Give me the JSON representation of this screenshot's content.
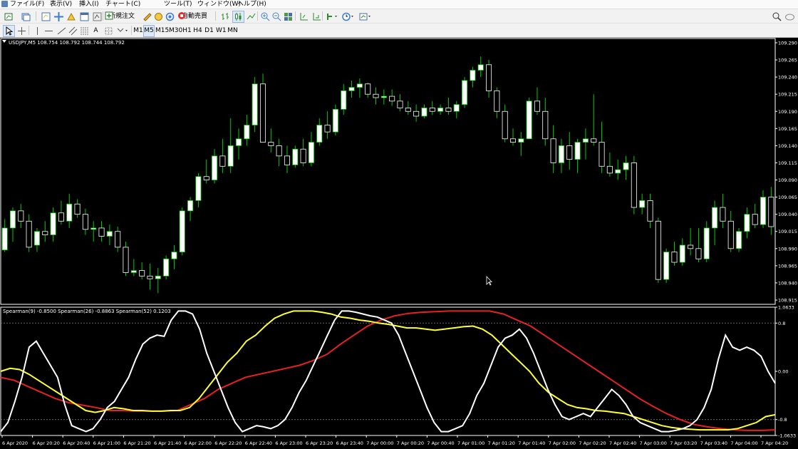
{
  "menu": {
    "items": [
      "ファイル(F)",
      "表示(V)",
      "挿入(I)",
      "チャート(C)",
      "ツール(T)",
      "ウィンドウ(W)",
      "ヘルプ(H)"
    ]
  },
  "toolbar": {
    "new_order_label": "新規注文",
    "auto_trade_label": "自動売買",
    "timeframes": [
      "M1",
      "M5",
      "M15",
      "M30",
      "H1",
      "H4",
      "D1",
      "W1",
      "MN"
    ],
    "active_timeframe": "M5",
    "text_tool_label": "A"
  },
  "price_chart": {
    "header": "USDJPY,M5  108.754 108.792 108.744 108.792",
    "price_labels": [
      "109.290",
      "109.265",
      "109.240",
      "109.215",
      "109.190",
      "109.165",
      "109.140",
      "109.115",
      "109.090",
      "109.065",
      "109.040",
      "109.015",
      "108.990",
      "108.965",
      "108.940",
      "108.915"
    ]
  },
  "indicator": {
    "header": "Spearman(9) -0.8500  Spearman(26) -0.8863  Spearman(52) 0.1203",
    "scale_labels": [
      "1.0633",
      "0.8",
      "0.00",
      "-0.8",
      "-1.0633"
    ]
  },
  "time_axis": {
    "labels": [
      "6 Apr 2020",
      "6 Apr 20:20",
      "6 Apr 20:40",
      "6 Apr 21:00",
      "6 Apr 21:20",
      "6 Apr 21:40",
      "6 Apr 22:00",
      "6 Apr 22:20",
      "6 Apr 22:40",
      "6 Apr 23:00",
      "6 Apr 23:20",
      "6 Apr 23:40",
      "7 Apr 00:00",
      "7 Apr 00:20",
      "7 Apr 00:40",
      "7 Apr 01:00",
      "7 Apr 01:20",
      "7 Apr 01:40",
      "7 Apr 02:00",
      "7 Apr 02:20",
      "7 Apr 02:40",
      "7 Apr 03:00",
      "7 Apr 03:20",
      "7 Apr 03:40",
      "7 Apr 04:00",
      "7 Apr 04:20"
    ]
  },
  "colors": {
    "chart_bg": "#000000",
    "bull_body": "#ffffff",
    "wick": "#00cc00",
    "spearman_fast": "#ffffff",
    "spearman_mid": "#ffff33",
    "spearman_slow": "#e52222",
    "level_line": "#888888"
  },
  "chart_data": {
    "type": "candlestick",
    "symbol": "USDJPY",
    "timeframe": "M5",
    "ylim": [
      108.915,
      109.29
    ],
    "candles": [
      [
        108.988,
        109.033,
        108.985,
        109.02
      ],
      [
        109.02,
        109.05,
        109.0,
        109.045
      ],
      [
        109.045,
        109.055,
        109.02,
        109.03
      ],
      [
        109.03,
        109.04,
        108.985,
        108.992
      ],
      [
        108.995,
        109.02,
        108.985,
        109.015
      ],
      [
        109.015,
        109.03,
        109.0,
        109.01
      ],
      [
        109.01,
        109.05,
        109.0,
        109.042
      ],
      [
        109.042,
        109.06,
        109.025,
        109.03
      ],
      [
        109.03,
        109.07,
        109.02,
        109.055
      ],
      [
        109.055,
        109.062,
        109.035,
        109.04
      ],
      [
        109.04,
        109.048,
        109.01,
        109.018
      ],
      [
        109.018,
        109.03,
        109.0,
        109.02
      ],
      [
        109.02,
        109.03,
        109.0,
        109.008
      ],
      [
        109.008,
        109.025,
        108.995,
        109.015
      ],
      [
        109.015,
        109.022,
        108.985,
        108.992
      ],
      [
        108.992,
        109.0,
        108.95,
        108.955
      ],
      [
        108.955,
        108.975,
        108.95,
        108.958
      ],
      [
        108.958,
        108.97,
        108.945,
        108.95
      ],
      [
        108.95,
        108.968,
        108.93,
        108.946
      ],
      [
        108.946,
        108.962,
        108.925,
        108.95
      ],
      [
        108.95,
        108.98,
        108.945,
        108.975
      ],
      [
        108.975,
        108.995,
        108.96,
        108.985
      ],
      [
        108.985,
        109.05,
        108.98,
        109.045
      ],
      [
        109.045,
        109.065,
        109.03,
        109.06
      ],
      [
        109.06,
        109.1,
        109.05,
        109.095
      ],
      [
        109.095,
        109.12,
        109.085,
        109.09
      ],
      [
        109.09,
        109.135,
        109.085,
        109.125
      ],
      [
        109.125,
        109.15,
        109.1,
        109.11
      ],
      [
        109.11,
        109.18,
        109.1,
        109.14
      ],
      [
        109.14,
        109.165,
        109.12,
        109.15
      ],
      [
        109.15,
        109.185,
        109.14,
        109.17
      ],
      [
        109.17,
        109.24,
        109.16,
        109.23
      ],
      [
        109.23,
        109.245,
        109.15,
        109.145
      ],
      [
        109.145,
        109.165,
        109.13,
        109.14
      ],
      [
        109.14,
        109.15,
        109.11,
        109.125
      ],
      [
        109.125,
        109.14,
        109.1,
        109.112
      ],
      [
        109.112,
        109.14,
        109.108,
        109.135
      ],
      [
        109.135,
        109.15,
        109.11,
        109.115
      ],
      [
        109.115,
        109.16,
        109.11,
        109.145
      ],
      [
        109.145,
        109.18,
        109.14,
        109.17
      ],
      [
        109.17,
        109.19,
        109.15,
        109.16
      ],
      [
        109.16,
        109.2,
        109.155,
        109.193
      ],
      [
        109.193,
        109.23,
        109.185,
        109.22
      ],
      [
        109.22,
        109.235,
        109.21,
        109.225
      ],
      [
        109.225,
        109.238,
        109.21,
        109.23
      ],
      [
        109.23,
        109.232,
        109.21,
        109.215
      ],
      [
        109.215,
        109.225,
        109.2,
        109.21
      ],
      [
        109.21,
        109.222,
        109.2,
        109.212
      ],
      [
        109.212,
        109.222,
        109.198,
        109.205
      ],
      [
        109.205,
        109.215,
        109.19,
        109.195
      ],
      [
        109.195,
        109.205,
        109.185,
        109.19
      ],
      [
        109.19,
        109.2,
        109.175,
        109.183
      ],
      [
        109.183,
        109.2,
        109.18,
        109.195
      ],
      [
        109.195,
        109.205,
        109.185,
        109.19
      ],
      [
        109.19,
        109.2,
        109.185,
        109.195
      ],
      [
        109.195,
        109.21,
        109.185,
        109.19
      ],
      [
        109.19,
        109.205,
        109.18,
        109.2
      ],
      [
        109.2,
        109.24,
        109.195,
        109.235
      ],
      [
        109.235,
        109.255,
        109.225,
        109.25
      ],
      [
        109.25,
        109.27,
        109.24,
        109.258
      ],
      [
        109.258,
        109.265,
        109.21,
        109.22
      ],
      [
        109.22,
        109.225,
        109.18,
        109.19
      ],
      [
        109.19,
        109.2,
        109.145,
        109.15
      ],
      [
        109.15,
        109.165,
        109.14,
        109.145
      ],
      [
        109.145,
        109.16,
        109.125,
        109.15
      ],
      [
        109.15,
        109.21,
        109.15,
        109.205
      ],
      [
        109.205,
        109.225,
        109.185,
        109.19
      ],
      [
        109.19,
        109.21,
        109.14,
        109.15
      ],
      [
        109.15,
        109.17,
        109.1,
        109.115
      ],
      [
        109.115,
        109.15,
        109.1,
        109.14
      ],
      [
        109.14,
        109.16,
        109.105,
        109.12
      ],
      [
        109.12,
        109.15,
        109.1,
        109.145
      ],
      [
        109.145,
        109.165,
        109.12,
        109.15
      ],
      [
        109.15,
        109.215,
        109.14,
        109.145
      ],
      [
        109.145,
        109.175,
        109.1,
        109.11
      ],
      [
        109.11,
        109.13,
        109.095,
        109.1
      ],
      [
        109.1,
        109.12,
        109.09,
        109.105
      ],
      [
        109.105,
        109.125,
        109.09,
        109.115
      ],
      [
        109.115,
        109.125,
        109.04,
        109.05
      ],
      [
        109.05,
        109.07,
        109.04,
        109.06
      ],
      [
        109.06,
        109.07,
        109.02,
        109.03
      ],
      [
        109.03,
        109.035,
        108.94,
        108.945
      ],
      [
        108.945,
        108.99,
        108.94,
        108.985
      ],
      [
        108.985,
        109.0,
        108.965,
        108.97
      ],
      [
        108.97,
        109.005,
        108.965,
        108.995
      ],
      [
        108.995,
        109.02,
        108.98,
        108.99
      ],
      [
        108.99,
        109.02,
        108.97,
        108.975
      ],
      [
        108.975,
        109.03,
        108.97,
        109.02
      ],
      [
        109.02,
        109.06,
        108.995,
        109.05
      ],
      [
        109.05,
        109.07,
        109.02,
        109.03
      ],
      [
        109.03,
        109.045,
        108.985,
        108.99
      ],
      [
        108.99,
        109.02,
        108.985,
        109.015
      ],
      [
        109.015,
        109.05,
        109.005,
        109.04
      ],
      [
        109.04,
        109.055,
        109.02,
        109.025
      ],
      [
        109.025,
        109.075,
        109.02,
        109.065
      ],
      [
        109.065,
        109.08,
        109.01,
        109.022
      ]
    ],
    "indicators": [
      {
        "name": "Spearman(9)",
        "last": -0.85,
        "values": [
          -1.0,
          -0.85,
          -0.5,
          -0.1,
          0.4,
          0.5,
          0.3,
          0.1,
          -0.1,
          -0.55,
          -0.9,
          -0.95,
          -1.0,
          -0.95,
          -0.8,
          -0.6,
          -0.5,
          -0.3,
          -0.1,
          0.2,
          0.45,
          0.55,
          0.6,
          0.58,
          0.85,
          1.0,
          1.0,
          0.95,
          0.7,
          0.3,
          0.0,
          -0.3,
          -0.6,
          -0.85,
          -1.0,
          -0.95,
          -0.9,
          -0.92,
          -0.95,
          -0.9,
          -0.8,
          -0.6,
          -0.35,
          -0.15,
          0.1,
          0.35,
          0.6,
          0.85,
          1.0,
          1.0,
          0.98,
          0.95,
          0.92,
          0.9,
          0.85,
          0.8,
          0.6,
          0.3,
          0.0,
          -0.3,
          -0.6,
          -0.85,
          -1.0,
          -1.0,
          -0.95,
          -0.9,
          -0.7,
          -0.4,
          -0.2,
          0.1,
          0.4,
          0.55,
          0.6,
          0.7,
          0.55,
          0.3,
          0.0,
          -0.3,
          -0.55,
          -0.75,
          -0.8,
          -0.75,
          -0.7,
          -0.75,
          -0.6,
          -0.45,
          -0.3,
          -0.4,
          -0.55,
          -0.75,
          -0.85,
          -0.9,
          -0.95,
          -1.0,
          -1.0,
          -0.98,
          -0.95,
          -0.9,
          -0.8,
          -0.6,
          -0.3,
          0.2,
          0.6,
          0.4,
          0.35,
          0.4,
          0.35,
          0.25,
          0.0,
          -0.2
        ]
      },
      {
        "name": "Spearman(26)",
        "last": -0.8863,
        "values": [
          0.0,
          0.05,
          0.03,
          -0.05,
          -0.15,
          -0.25,
          -0.35,
          -0.45,
          -0.55,
          -0.65,
          -0.68,
          -0.65,
          -0.6,
          -0.62,
          -0.65,
          -0.65,
          -0.66,
          -0.66,
          -0.65,
          -0.65,
          -0.6,
          -0.45,
          -0.25,
          -0.05,
          0.15,
          0.3,
          0.5,
          0.6,
          0.75,
          0.88,
          0.95,
          1.0,
          1.0,
          1.0,
          0.98,
          0.95,
          0.9,
          0.88,
          0.85,
          0.83,
          0.8,
          0.78,
          0.75,
          0.72,
          0.72,
          0.7,
          0.68,
          0.7,
          0.72,
          0.74,
          0.75,
          0.7,
          0.6,
          0.45,
          0.3,
          0.15,
          0.0,
          -0.2,
          -0.35,
          -0.45,
          -0.55,
          -0.6,
          -0.62,
          -0.65,
          -0.66,
          -0.68,
          -0.7,
          -0.75,
          -0.8,
          -0.85,
          -0.9,
          -0.93,
          -0.95,
          -0.96,
          -0.97,
          -0.97,
          -0.97,
          -0.97,
          -0.95,
          -0.9,
          -0.85,
          -0.75,
          -0.72
        ]
      },
      {
        "name": "Spearman(52)",
        "last": 0.1203,
        "values": [
          -0.1,
          -0.15,
          -0.25,
          -0.35,
          -0.45,
          -0.52,
          -0.56,
          -0.6,
          -0.65,
          -0.65,
          -0.66,
          -0.66,
          -0.66,
          -0.65,
          -0.55,
          -0.45,
          -0.3,
          -0.2,
          -0.1,
          -0.05,
          0.0,
          0.05,
          0.1,
          0.18,
          0.28,
          0.45,
          0.6,
          0.75,
          0.85,
          0.92,
          0.96,
          0.98,
          0.99,
          1.0,
          1.0,
          1.0,
          1.0,
          0.95,
          0.85,
          0.75,
          0.6,
          0.45,
          0.3,
          0.15,
          0.0,
          -0.15,
          -0.3,
          -0.45,
          -0.58,
          -0.7,
          -0.8,
          -0.88,
          -0.92,
          -0.95,
          -0.97,
          -0.98,
          -0.98,
          -0.97
        ]
      }
    ],
    "indicator_range": [
      -1.0633,
      1.0633
    ],
    "levels": [
      0.8,
      -0.8
    ]
  }
}
